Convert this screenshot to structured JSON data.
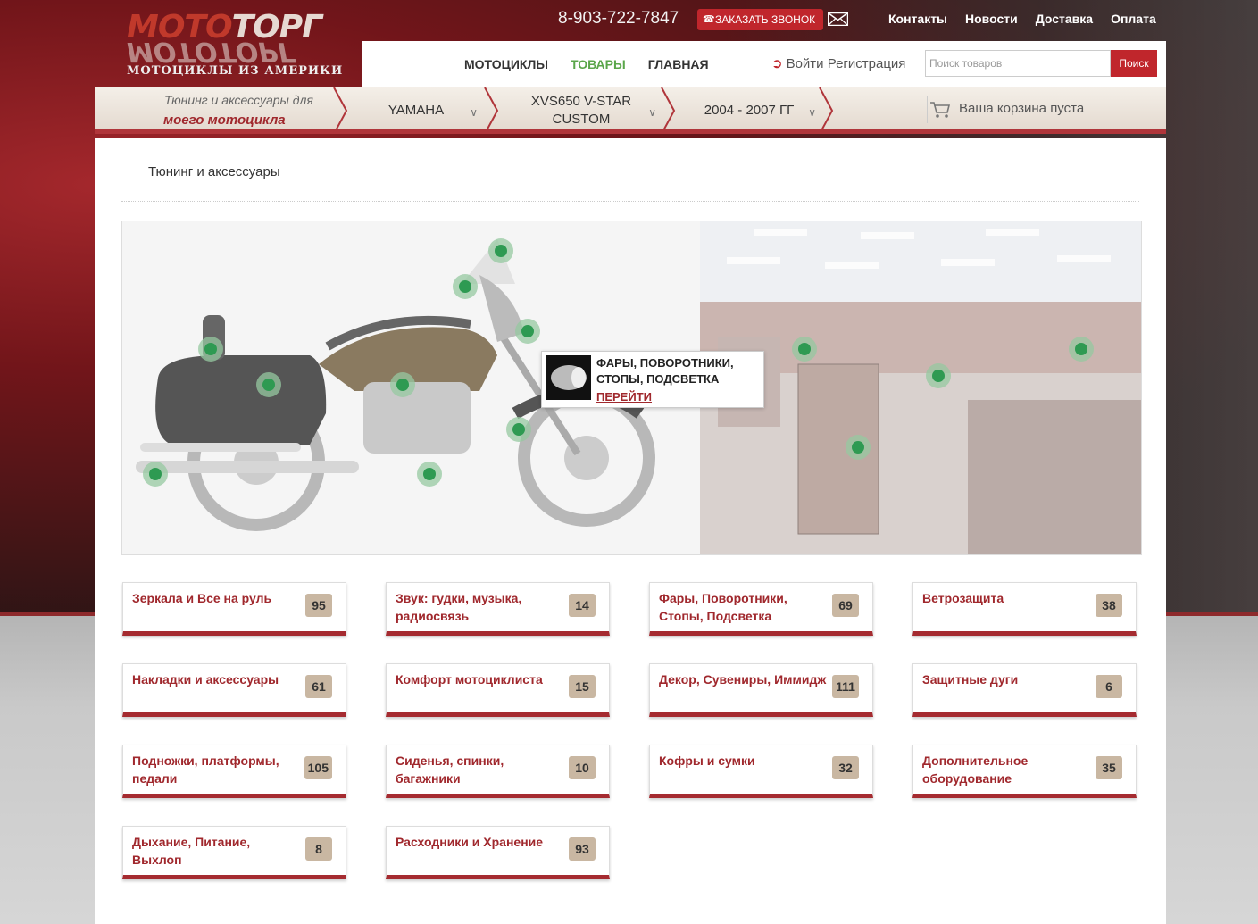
{
  "header": {
    "logo_word1a": "МОТО",
    "logo_word1b": "ТОРГ",
    "logo_word2": "МОТОТОРГ",
    "logo_subtitle": "МОТОЦИКЛЫ ИЗ АМЕРИКИ",
    "phone": "8-903-722-7847",
    "callback_label": "ЗАКАЗАТЬ ЗВОНОК",
    "top_links": [
      "Контакты",
      "Новости",
      "Доставка",
      "Оплата"
    ]
  },
  "nav": {
    "items": [
      {
        "label": "МОТОЦИКЛЫ",
        "active": false
      },
      {
        "label": "ТОВАРЫ",
        "active": true
      },
      {
        "label": "ГЛАВНАЯ",
        "active": false
      }
    ],
    "login_label": "Войти",
    "register_label": "Регистрация",
    "search_placeholder": "Поиск товаров",
    "search_button": "Поиск"
  },
  "selector": {
    "intro_line1": "Тюнинг и аксессуары для",
    "intro_line2": "моего мотоцикла",
    "brand": "YAMAHA",
    "model": "XVS650 V-STAR CUSTOM",
    "years": "2004 - 2007 ГГ",
    "cart": "Ваша корзина пуста"
  },
  "breadcrumb": "Тюнинг и аксессуары",
  "tooltip": {
    "title": "ФАРЫ, ПОВОРОТНИКИ, СТОПЫ, ПОДСВЕТКА",
    "link": "ПЕРЕЙТИ"
  },
  "categories": [
    {
      "name": "Зеркала и Все на руль",
      "count": "95"
    },
    {
      "name": "Звук: гудки, музыка, радиосвязь",
      "count": "14"
    },
    {
      "name": "Фары, Поворотники, Стопы, Подсветка",
      "count": "69"
    },
    {
      "name": "Ветрозащита",
      "count": "38"
    },
    {
      "name": "Накладки и аксессуары",
      "count": "61"
    },
    {
      "name": "Комфорт мотоциклиста",
      "count": "15"
    },
    {
      "name": "Декор, Сувениры, Иммидж",
      "count": "111"
    },
    {
      "name": "Защитные дуги",
      "count": "6"
    },
    {
      "name": "Подножки, платформы, педали",
      "count": "105"
    },
    {
      "name": "Сиденья, спинки, багажники",
      "count": "10"
    },
    {
      "name": "Кофры и сумки",
      "count": "32"
    },
    {
      "name": "Дополнительное оборудование",
      "count": "35"
    },
    {
      "name": "Дыхание, Питание, Выхлоп",
      "count": "8"
    },
    {
      "name": "Расходники и Хранение",
      "count": "93"
    }
  ],
  "colors": {
    "brand_red": "#c0262c",
    "accent_green": "#5aa64a",
    "category_red": "#a0282d",
    "count_badge": "#c9b7a2"
  }
}
